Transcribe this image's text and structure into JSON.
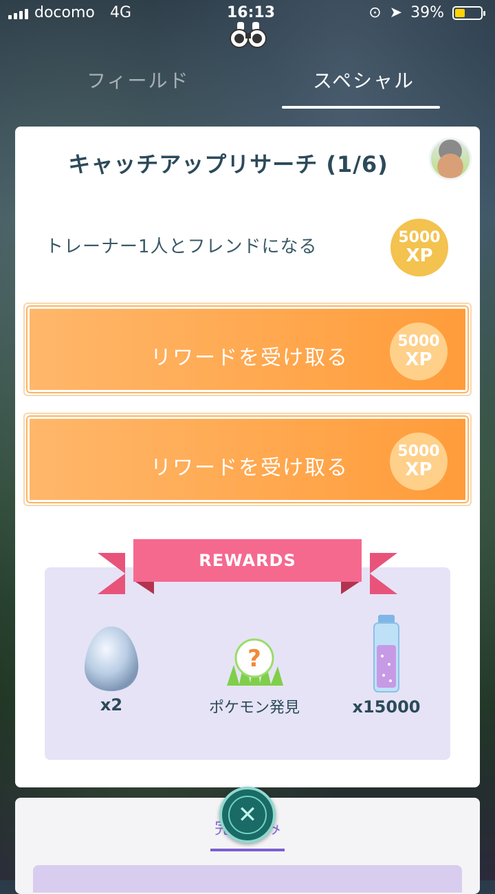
{
  "status": {
    "carrier": "docomo",
    "network": "4G",
    "time": "16:13",
    "battery": "39%",
    "battery_level": 0.39
  },
  "tabs": {
    "field": "フィールド",
    "special": "スペシャル"
  },
  "card": {
    "title": "キャッチアップリサーチ (1/6)",
    "task": {
      "text": "トレーナー1人とフレンドになる",
      "xp_amount": "5000",
      "xp_unit": "XP"
    },
    "reward_buttons": [
      {
        "label": "リワードを受け取る",
        "xp_amount": "5000",
        "xp_unit": "XP"
      },
      {
        "label": "リワードを受け取る",
        "xp_amount": "5000",
        "xp_unit": "XP"
      }
    ]
  },
  "rewards": {
    "title": "REWARDS",
    "items": [
      {
        "icon": "egg-icon",
        "text": "x2"
      },
      {
        "icon": "pokemon-encounter-icon",
        "text": "ポケモン発見"
      },
      {
        "icon": "stardust-icon",
        "text": "x15000"
      }
    ]
  },
  "bottom": {
    "tab_label": "完了済み"
  },
  "colors": {
    "accent_orange": "#ff9c3a",
    "ribbon_pink": "#f5698f",
    "teal": "#1a6a66"
  }
}
